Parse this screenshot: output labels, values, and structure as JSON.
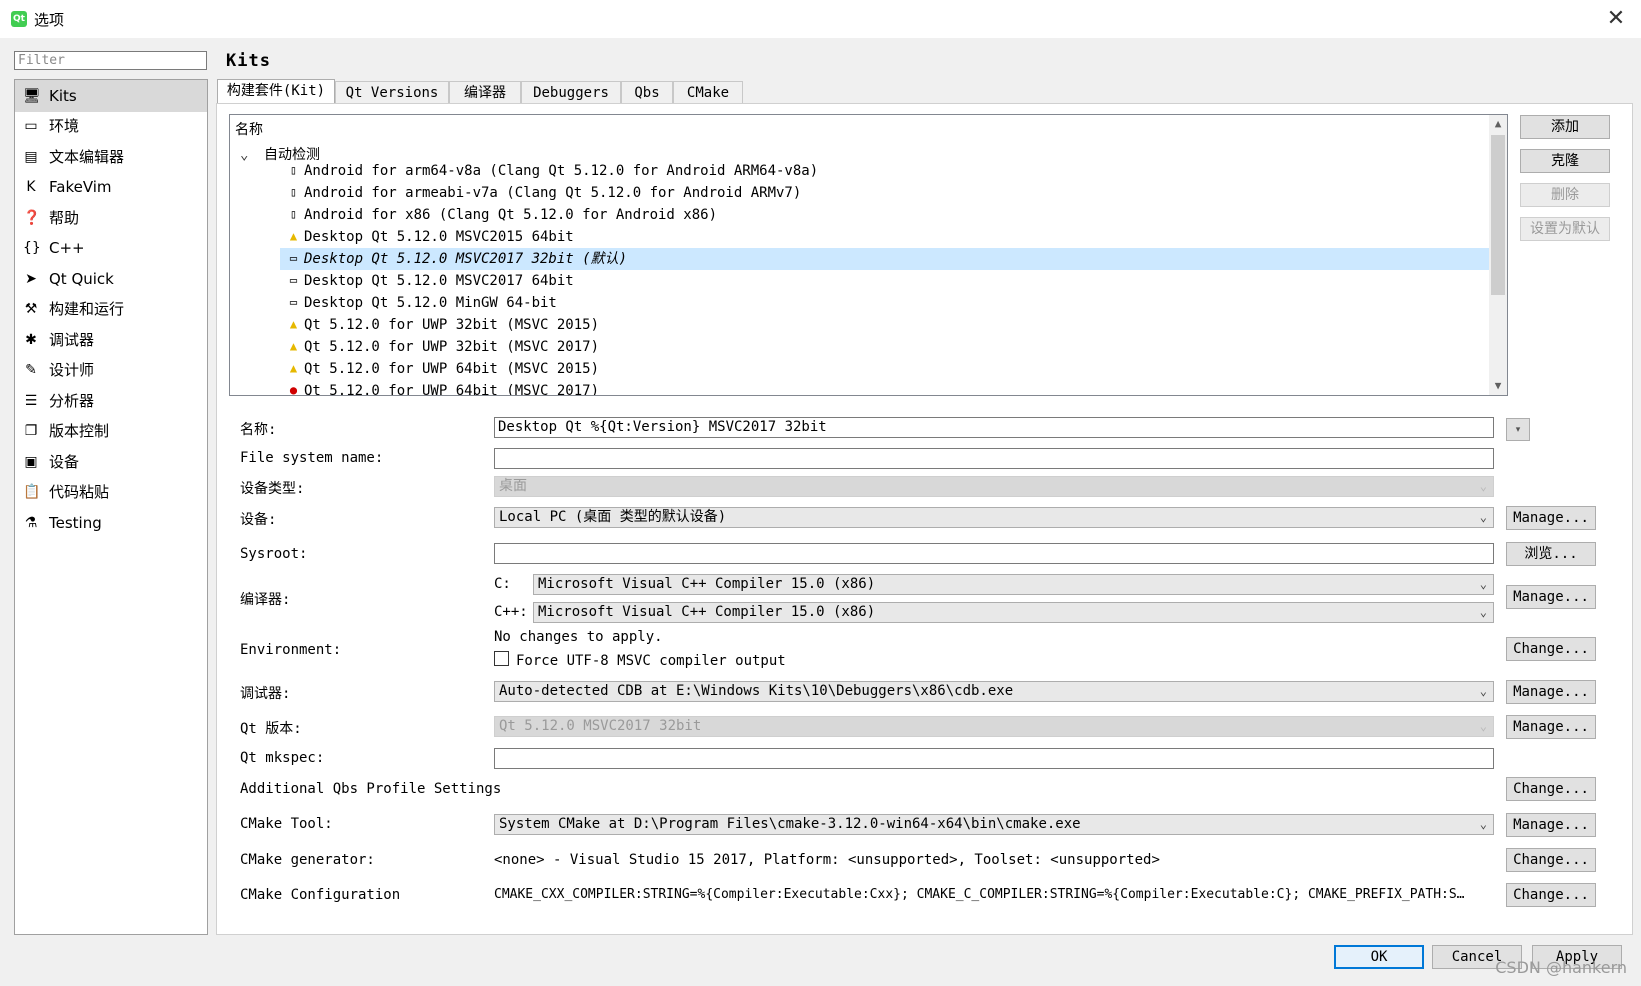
{
  "window": {
    "title": "选项",
    "app_icon_text": "Qt"
  },
  "sidebar": {
    "filter_placeholder": "Filter",
    "items": [
      {
        "label": "Kits",
        "icon": "kits-icon"
      },
      {
        "label": "环境",
        "icon": "monitor-icon"
      },
      {
        "label": "文本编辑器",
        "icon": "text-editor-icon"
      },
      {
        "label": "FakeVim",
        "icon": "fakevim-icon"
      },
      {
        "label": "帮助",
        "icon": "help-icon"
      },
      {
        "label": "C++",
        "icon": "braces-icon"
      },
      {
        "label": "Qt Quick",
        "icon": "qt-quick-icon"
      },
      {
        "label": "构建和运行",
        "icon": "hammer-icon"
      },
      {
        "label": "调试器",
        "icon": "bug-icon"
      },
      {
        "label": "设计师",
        "icon": "pencil-icon"
      },
      {
        "label": "分析器",
        "icon": "analyzer-icon"
      },
      {
        "label": "版本控制",
        "icon": "version-control-icon"
      },
      {
        "label": "设备",
        "icon": "device-icon"
      },
      {
        "label": "代码粘贴",
        "icon": "code-paste-icon"
      },
      {
        "label": "Testing",
        "icon": "flask-icon"
      }
    ]
  },
  "main": {
    "title": "Kits",
    "tabs": [
      "构建套件(Kit)",
      "Qt Versions",
      "编译器",
      "Debuggers",
      "Qbs",
      "CMake"
    ],
    "tree": {
      "header": "名称",
      "group": "自动检测",
      "kits": [
        {
          "label": "Android for arm64-v8a (Clang Qt 5.12.0 for Android ARM64-v8a)",
          "icon": "android-device-icon"
        },
        {
          "label": "Android for armeabi-v7a (Clang Qt 5.12.0 for Android ARMv7)",
          "icon": "android-device-icon"
        },
        {
          "label": "Android for x86 (Clang Qt 5.12.0 for Android x86)",
          "icon": "android-device-icon"
        },
        {
          "label": "Desktop Qt 5.12.0 MSVC2015 64bit",
          "icon": "warning-icon"
        },
        {
          "label": "Desktop Qt 5.12.0 MSVC2017 32bit (默认)",
          "icon": "desktop-icon"
        },
        {
          "label": "Desktop Qt 5.12.0 MSVC2017 64bit",
          "icon": "desktop-icon"
        },
        {
          "label": "Desktop Qt 5.12.0 MinGW 64-bit",
          "icon": "desktop-icon"
        },
        {
          "label": "Qt 5.12.0 for UWP 32bit (MSVC 2015)",
          "icon": "warning-icon"
        },
        {
          "label": "Qt 5.12.0 for UWP 32bit (MSVC 2017)",
          "icon": "warning-icon"
        },
        {
          "label": "Qt 5.12.0 for UWP 64bit (MSVC 2015)",
          "icon": "warning-icon"
        },
        {
          "label": "Qt 5.12.0 for UWP 64bit (MSVC 2017)",
          "icon": "error-icon"
        }
      ]
    },
    "buttons": {
      "add": "添加",
      "clone": "克隆",
      "remove": "删除",
      "make_default": "设置为默认"
    },
    "form": {
      "name_label": "名称:",
      "name_value": "Desktop Qt %{Qt:Version} MSVC2017 32bit",
      "fs_label": "File system name:",
      "fs_value": "",
      "device_type_label": "设备类型:",
      "device_type_value": "桌面",
      "device_label": "设备:",
      "device_value": "Local PC (桌面 类型的默认设备)",
      "sysroot_label": "Sysroot:",
      "sysroot_value": "",
      "compiler_label": "编译器:",
      "c_label": "C:",
      "c_value": "Microsoft Visual C++ Compiler 15.0 (x86)",
      "cpp_label": "C++:",
      "cpp_value": "Microsoft Visual C++ Compiler 15.0 (x86)",
      "env_label": "Environment:",
      "env_text": "No changes to apply.",
      "env_checkbox": "Force UTF-8 MSVC compiler output",
      "debugger_label": "调试器:",
      "debugger_value": "Auto-detected CDB at E:\\Windows Kits\\10\\Debuggers\\x86\\cdb.exe",
      "qt_version_label": "Qt 版本:",
      "qt_version_value": "Qt 5.12.0 MSVC2017 32bit",
      "mkspec_label": "Qt mkspec:",
      "mkspec_value": "",
      "qbs_label": "Additional Qbs Profile Settings",
      "cmake_tool_label": "CMake Tool:",
      "cmake_tool_value": "System CMake at D:\\Program Files\\cmake-3.12.0-win64-x64\\bin\\cmake.exe",
      "cmake_gen_label": "CMake generator:",
      "cmake_gen_value": "<none> - Visual Studio 15 2017, Platform: <unsupported>, Toolset: <unsupported>",
      "cmake_conf_label": "CMake Configuration",
      "cmake_conf_value": "CMAKE_CXX_COMPILER:STRING=%{Compiler:Executable:Cxx}; CMAKE_C_COMPILER:STRING=%{Compiler:Executable:C}; CMAKE_PREFIX_PATH:S…",
      "manage": "Manage...",
      "browse": "浏览...",
      "change": "Change..."
    }
  },
  "footer": {
    "ok": "OK",
    "cancel": "Cancel",
    "apply": "Apply",
    "watermark": "CSDN @hankern"
  }
}
